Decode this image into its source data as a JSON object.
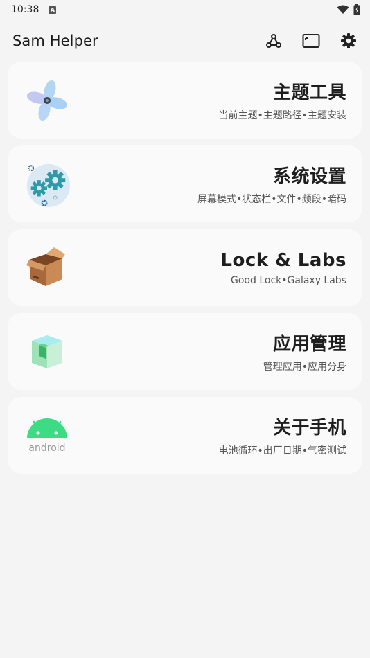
{
  "status_bar": {
    "time": "10:38",
    "badge": "A"
  },
  "app_bar": {
    "title": "Sam Helper"
  },
  "cards": [
    {
      "title": "主题工具",
      "subtitle": "当前主题•主题路径•主题安装",
      "icon": "fan-icon"
    },
    {
      "title": "系统设置",
      "subtitle": "屏幕模式•状态栏•文件•频段•暗码",
      "icon": "gears-icon"
    },
    {
      "title": "Lock & Labs",
      "subtitle": "Good Lock•Galaxy Labs",
      "icon": "box-icon"
    },
    {
      "title": "应用管理",
      "subtitle": "管理应用•应用分身",
      "icon": "cube-icon"
    },
    {
      "title": "关于手机",
      "subtitle": "电池循环•出厂日期•气密测试",
      "icon": "android-icon",
      "icon_text": "android"
    }
  ]
}
